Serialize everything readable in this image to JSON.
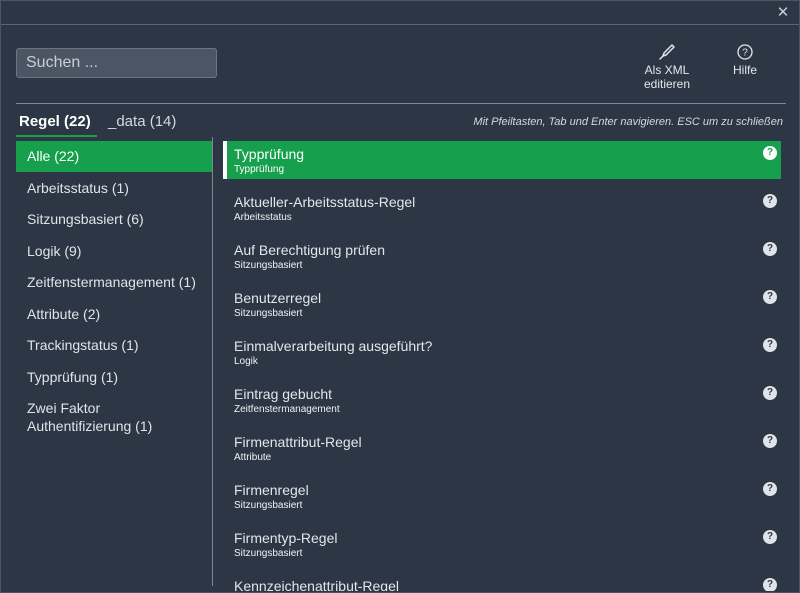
{
  "search": {
    "placeholder": "Suchen ..."
  },
  "toolbar": {
    "xml_label_line1": "Als XML",
    "xml_label_line2": "editieren",
    "help_label": "Hilfe"
  },
  "tabs": [
    {
      "label": "Regel (22)"
    },
    {
      "label": "_data (14)"
    }
  ],
  "hint": "Mit Pfeiltasten, Tab und Enter navigieren. ESC um zu schließen",
  "categories": [
    {
      "label": "Alle (22)"
    },
    {
      "label": "Arbeitsstatus (1)"
    },
    {
      "label": "Sitzungsbasiert (6)"
    },
    {
      "label": "Logik (9)"
    },
    {
      "label": "Zeitfenstermanagement (1)"
    },
    {
      "label": "Attribute (2)"
    },
    {
      "label": "Trackingstatus (1)"
    },
    {
      "label": "Typprüfung (1)"
    },
    {
      "label_line1": "Zwei Faktor",
      "label_line2": "Authentifizierung (1)"
    }
  ],
  "rules": [
    {
      "title": "Typprüfung",
      "category": "Typprüfung"
    },
    {
      "title": "Aktueller-Arbeitsstatus-Regel",
      "category": "Arbeitsstatus"
    },
    {
      "title": "Auf Berechtigung prüfen",
      "category": "Sitzungsbasiert"
    },
    {
      "title": "Benutzerregel",
      "category": "Sitzungsbasiert"
    },
    {
      "title": "Einmalverarbeitung ausgeführt?",
      "category": "Logik"
    },
    {
      "title": "Eintrag gebucht",
      "category": "Zeitfenstermanagement"
    },
    {
      "title": "Firmenattribut-Regel",
      "category": "Attribute"
    },
    {
      "title": "Firmenregel",
      "category": "Sitzungsbasiert"
    },
    {
      "title": "Firmentyp-Regel",
      "category": "Sitzungsbasiert"
    },
    {
      "title": "Kennzeichenattribut-Regel",
      "category": ""
    }
  ],
  "icons": {
    "close": "close-icon",
    "xml": "pen-nib-icon",
    "help": "question-circle-icon",
    "rule_help": "question-circle-icon"
  },
  "colors": {
    "accent": "#16a04e",
    "background": "#2d3644"
  }
}
